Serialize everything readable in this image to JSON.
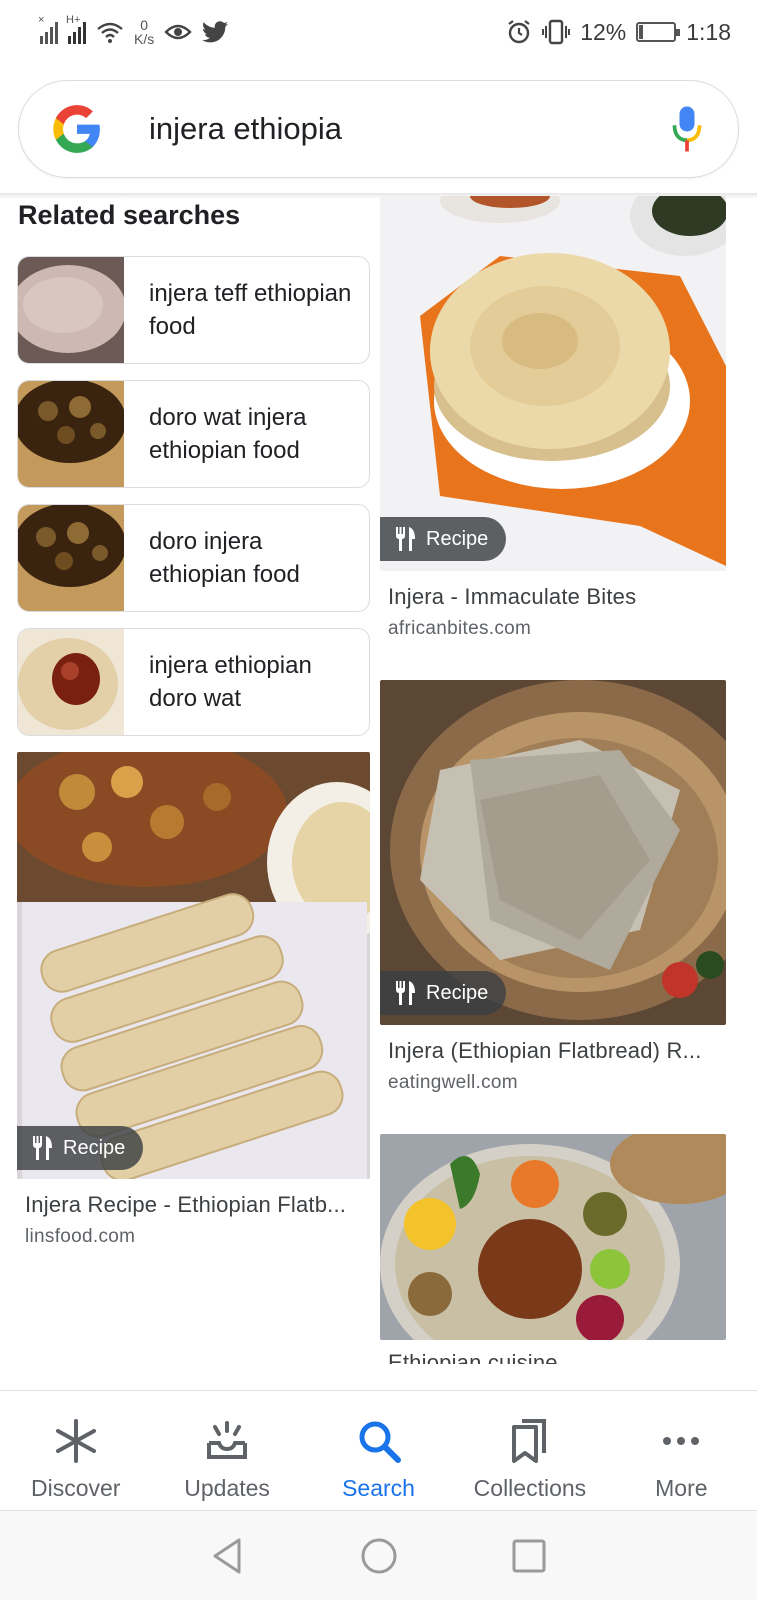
{
  "status_bar": {
    "speed_value": "0",
    "speed_unit": "K/s",
    "battery_percent": "12%",
    "battery_level": 0.12,
    "time": "1:18",
    "network_badge": "H+",
    "icons": [
      "signal-no-sim-icon",
      "signal-icon",
      "wifi-icon",
      "eye-icon",
      "twitter-icon",
      "alarm-icon",
      "vibrate-icon",
      "battery-icon"
    ]
  },
  "search": {
    "query": "injera ethiopia",
    "icons": [
      "google-logo",
      "mic-icon"
    ]
  },
  "related": {
    "title": "Related searches",
    "items": [
      {
        "label": "injera teff ethiopian food"
      },
      {
        "label": "doro wat injera ethiopian food"
      },
      {
        "label": "doro injera ethiopian food"
      },
      {
        "label": "injera ethiopian doro wat"
      }
    ]
  },
  "results": [
    {
      "badge": "Recipe",
      "title": "Injera - Immaculate Bites",
      "source": "africanbites.com"
    },
    {
      "badge": "Recipe",
      "title": "Injera (Ethiopian Flatbread) R...",
      "source": "eatingwell.com"
    },
    {
      "badge": "Recipe",
      "title": "Injera Recipe - Ethiopian Flatb...",
      "source": "linsfood.com"
    },
    {
      "title": "Ethiopian cuisine"
    }
  ],
  "bottom_nav": {
    "items": [
      {
        "label": "Discover",
        "icon": "asterisk-icon"
      },
      {
        "label": "Updates",
        "icon": "updates-icon"
      },
      {
        "label": "Search",
        "icon": "search-icon",
        "active": true
      },
      {
        "label": "Collections",
        "icon": "collections-icon"
      },
      {
        "label": "More",
        "icon": "more-icon"
      }
    ]
  },
  "colors": {
    "accent": "#1a73e8",
    "text_primary": "#202124",
    "text_secondary": "#5f6368",
    "border": "#dadce0"
  }
}
